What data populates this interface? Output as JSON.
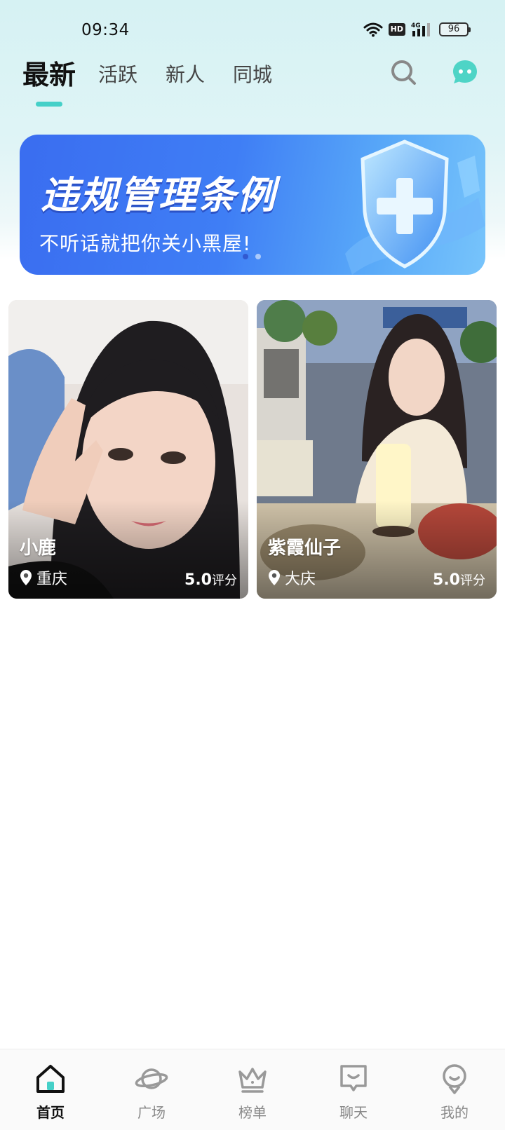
{
  "status_bar": {
    "time": "09:34",
    "network": "4G",
    "hd": "HD",
    "battery": "96"
  },
  "tabs": [
    {
      "label": "最新",
      "active": true
    },
    {
      "label": "活跃",
      "active": false
    },
    {
      "label": "新人",
      "active": false
    },
    {
      "label": "同城",
      "active": false
    }
  ],
  "header_icons": {
    "search": "search-icon",
    "chat": "chat-bubble-icon"
  },
  "banner": {
    "title": "违规管理条例",
    "subtitle": "不听话就把你关小黑屋!",
    "page_count": 2,
    "active_page": 1
  },
  "cards": [
    {
      "name": "小鹿",
      "location": "重庆",
      "rating": "5.0",
      "rating_unit": "评分"
    },
    {
      "name": "紫霞仙子",
      "location": "大庆",
      "rating": "5.0",
      "rating_unit": "评分"
    }
  ],
  "bottom_nav": [
    {
      "label": "首页",
      "icon": "home-icon",
      "active": true
    },
    {
      "label": "广场",
      "icon": "planet-icon",
      "active": false
    },
    {
      "label": "榜单",
      "icon": "crown-icon",
      "active": false
    },
    {
      "label": "聊天",
      "icon": "chat-icon",
      "active": false
    },
    {
      "label": "我的",
      "icon": "profile-icon",
      "active": false
    }
  ],
  "colors": {
    "accent": "#45d0c8",
    "banner_blue": "#3f7ef5",
    "header_bg": "#d6f2f3"
  }
}
